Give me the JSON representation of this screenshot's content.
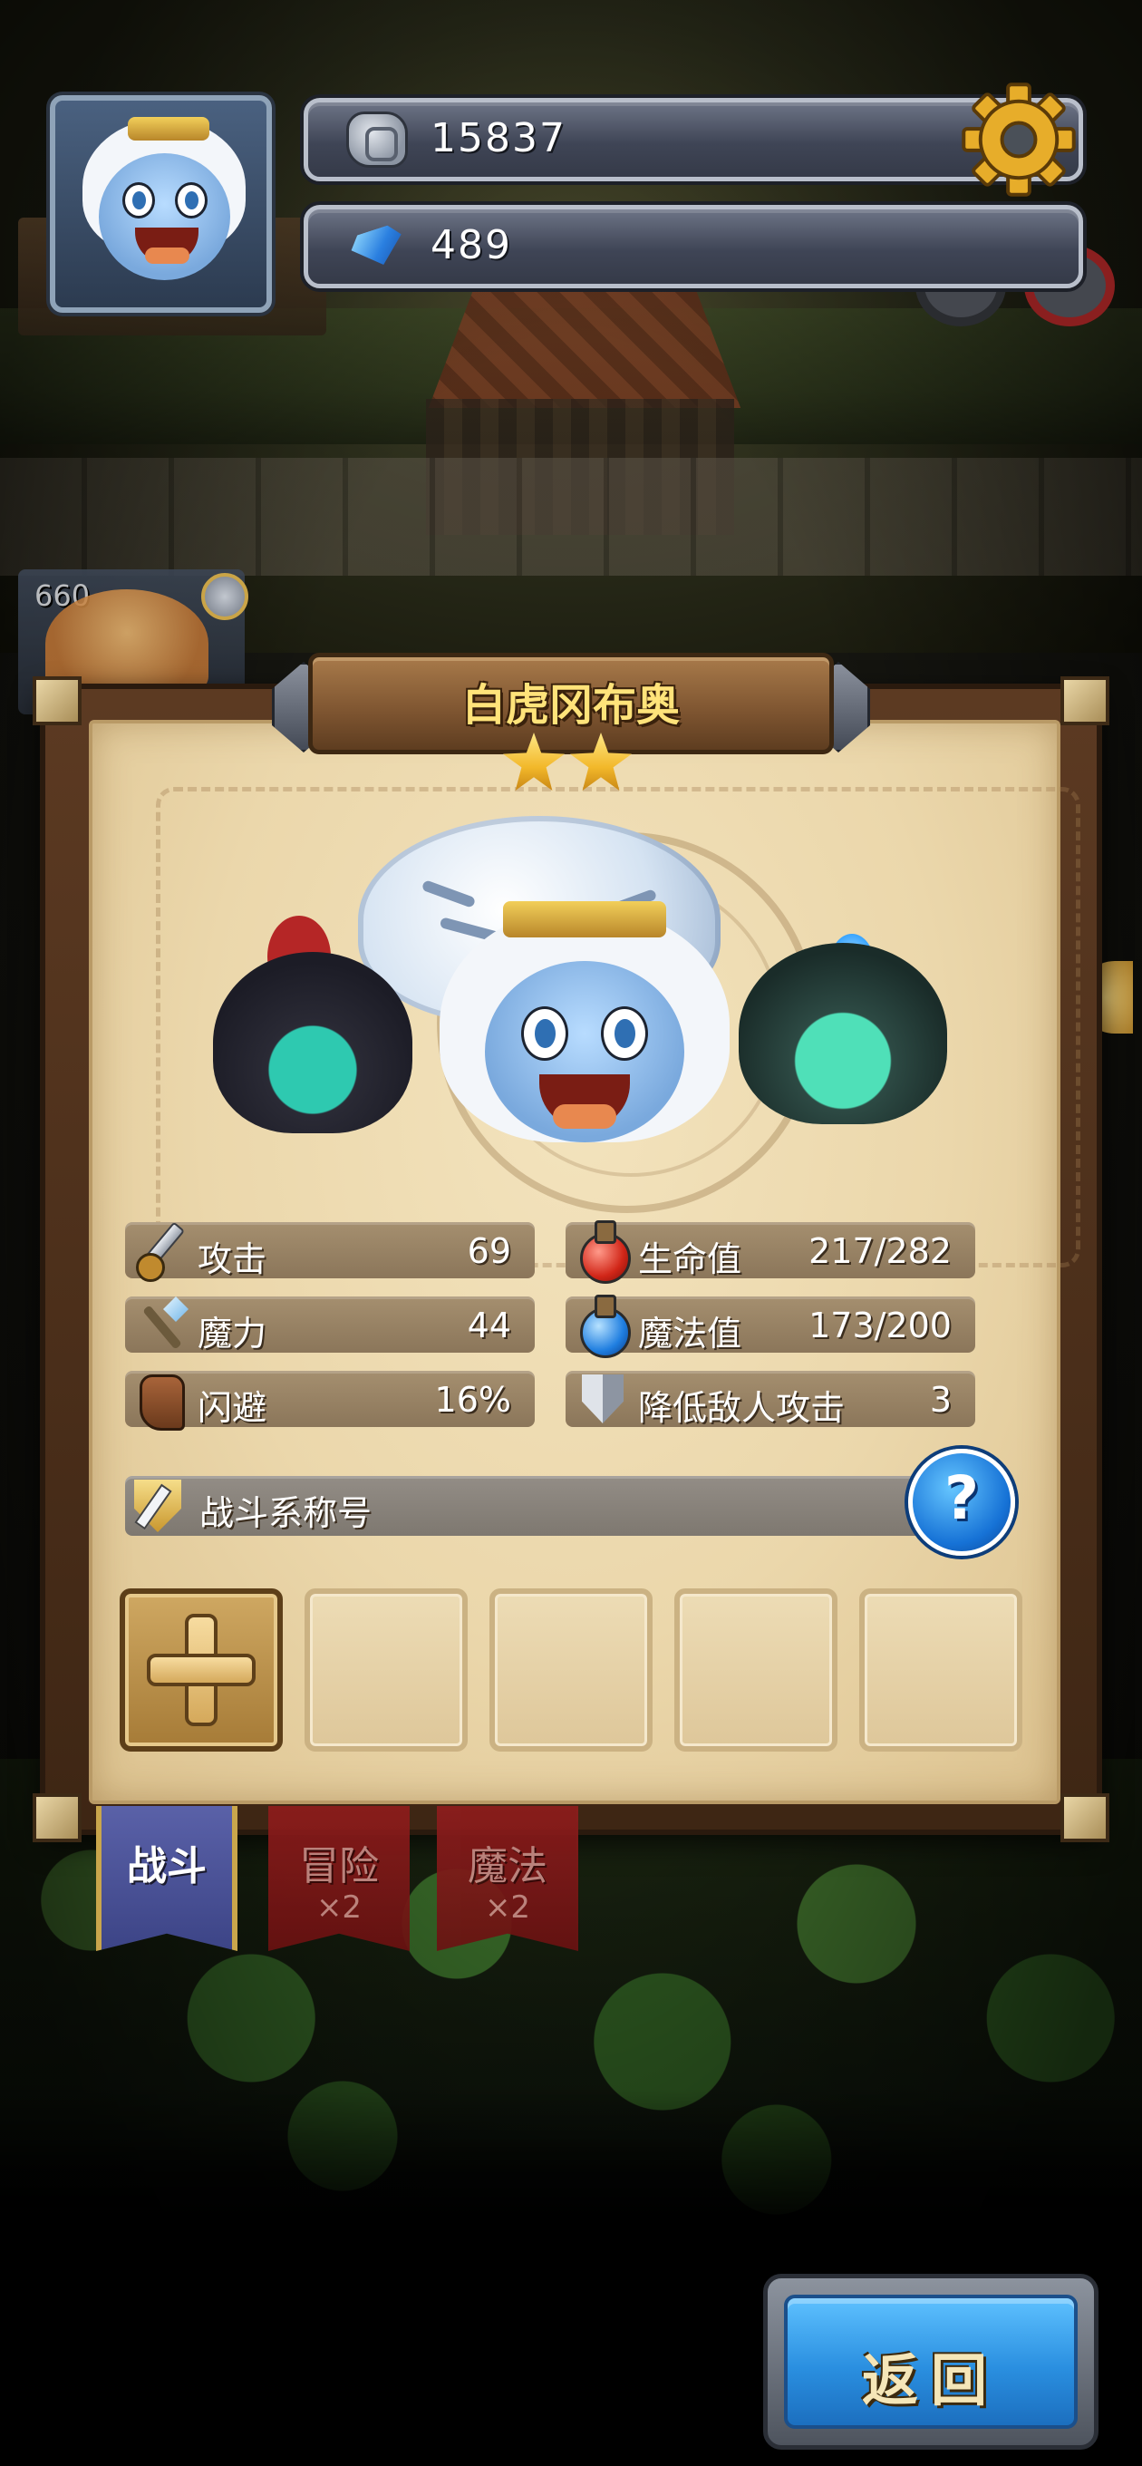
{
  "resources": {
    "stone_amount": "15837",
    "gem_amount": "489",
    "stone_icon": "rune-stone-icon",
    "gem_icon": "blue-gem-icon",
    "settings_icon": "gear-icon"
  },
  "background": {
    "side_counter": "660"
  },
  "hero": {
    "name": "白虎冈布奥",
    "stars": 2,
    "stats": {
      "attack": {
        "label": "攻击",
        "value": "69",
        "icon": "sword-icon"
      },
      "hp": {
        "label": "生命值",
        "value": "217/282",
        "icon": "red-potion-icon"
      },
      "magic": {
        "label": "魔力",
        "value": "44",
        "icon": "magic-wand-icon"
      },
      "mp": {
        "label": "魔法值",
        "value": "173/200",
        "icon": "blue-potion-icon"
      },
      "dodge": {
        "label": "闪避",
        "value": "16%",
        "icon": "boot-icon"
      },
      "reduce_attack": {
        "label": "降低敌人攻击",
        "value": "3",
        "icon": "shield-icon"
      }
    },
    "title_bar": {
      "label": "战斗系称号",
      "icon": "title-badge-icon"
    },
    "help_symbol": "?"
  },
  "tabs": [
    {
      "label": "战斗",
      "multiplier": "",
      "active": true
    },
    {
      "label": "冒险",
      "multiplier": "×2",
      "active": false
    },
    {
      "label": "魔法",
      "multiplier": "×2",
      "active": false
    }
  ],
  "back_button": {
    "label": "返回"
  },
  "colors": {
    "accent_gold": "#ffe37a",
    "parchment": "#ebd7ab",
    "tab_active": "#4a52a0",
    "tab_inactive": "#7d1818",
    "back_button": "#2a8fe0"
  }
}
